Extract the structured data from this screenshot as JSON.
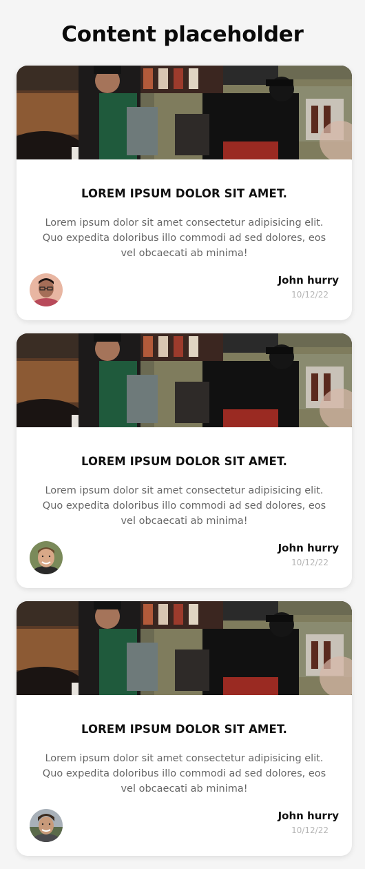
{
  "page": {
    "title": "Content placeholder"
  },
  "cards": [
    {
      "image_icon": "coffee-shop-photo",
      "title": "LOREM IPSUM DOLOR SIT AMET.",
      "text": "Lorem ipsum dolor sit amet consectetur adipisicing elit. Quo expedita doloribus illo commodi ad sed dolores, eos vel obcaecati ab minima!",
      "author": "John hurry",
      "date": "10/12/22",
      "avatar_icon": "avatar-glasses-man"
    },
    {
      "image_icon": "coffee-shop-photo",
      "title": "LOREM IPSUM DOLOR SIT AMET.",
      "text": "Lorem ipsum dolor sit amet consectetur adipisicing elit. Quo expedita doloribus illo commodi ad sed dolores, eos vel obcaecati ab minima!",
      "author": "John hurry",
      "date": "10/12/22",
      "avatar_icon": "avatar-smiling-man"
    },
    {
      "image_icon": "coffee-shop-photo",
      "title": "LOREM IPSUM DOLOR SIT AMET.",
      "text": "Lorem ipsum dolor sit amet consectetur adipisicing elit. Quo expedita doloribus illo commodi ad sed dolores, eos vel obcaecati ab minima!",
      "author": "John hurry",
      "date": "10/12/22",
      "avatar_icon": "avatar-outdoor-man"
    }
  ],
  "colors": {
    "background": "#f5f5f5",
    "card": "#ffffff",
    "title": "#111111",
    "body_text": "#666666",
    "date": "#b5b5b5"
  }
}
